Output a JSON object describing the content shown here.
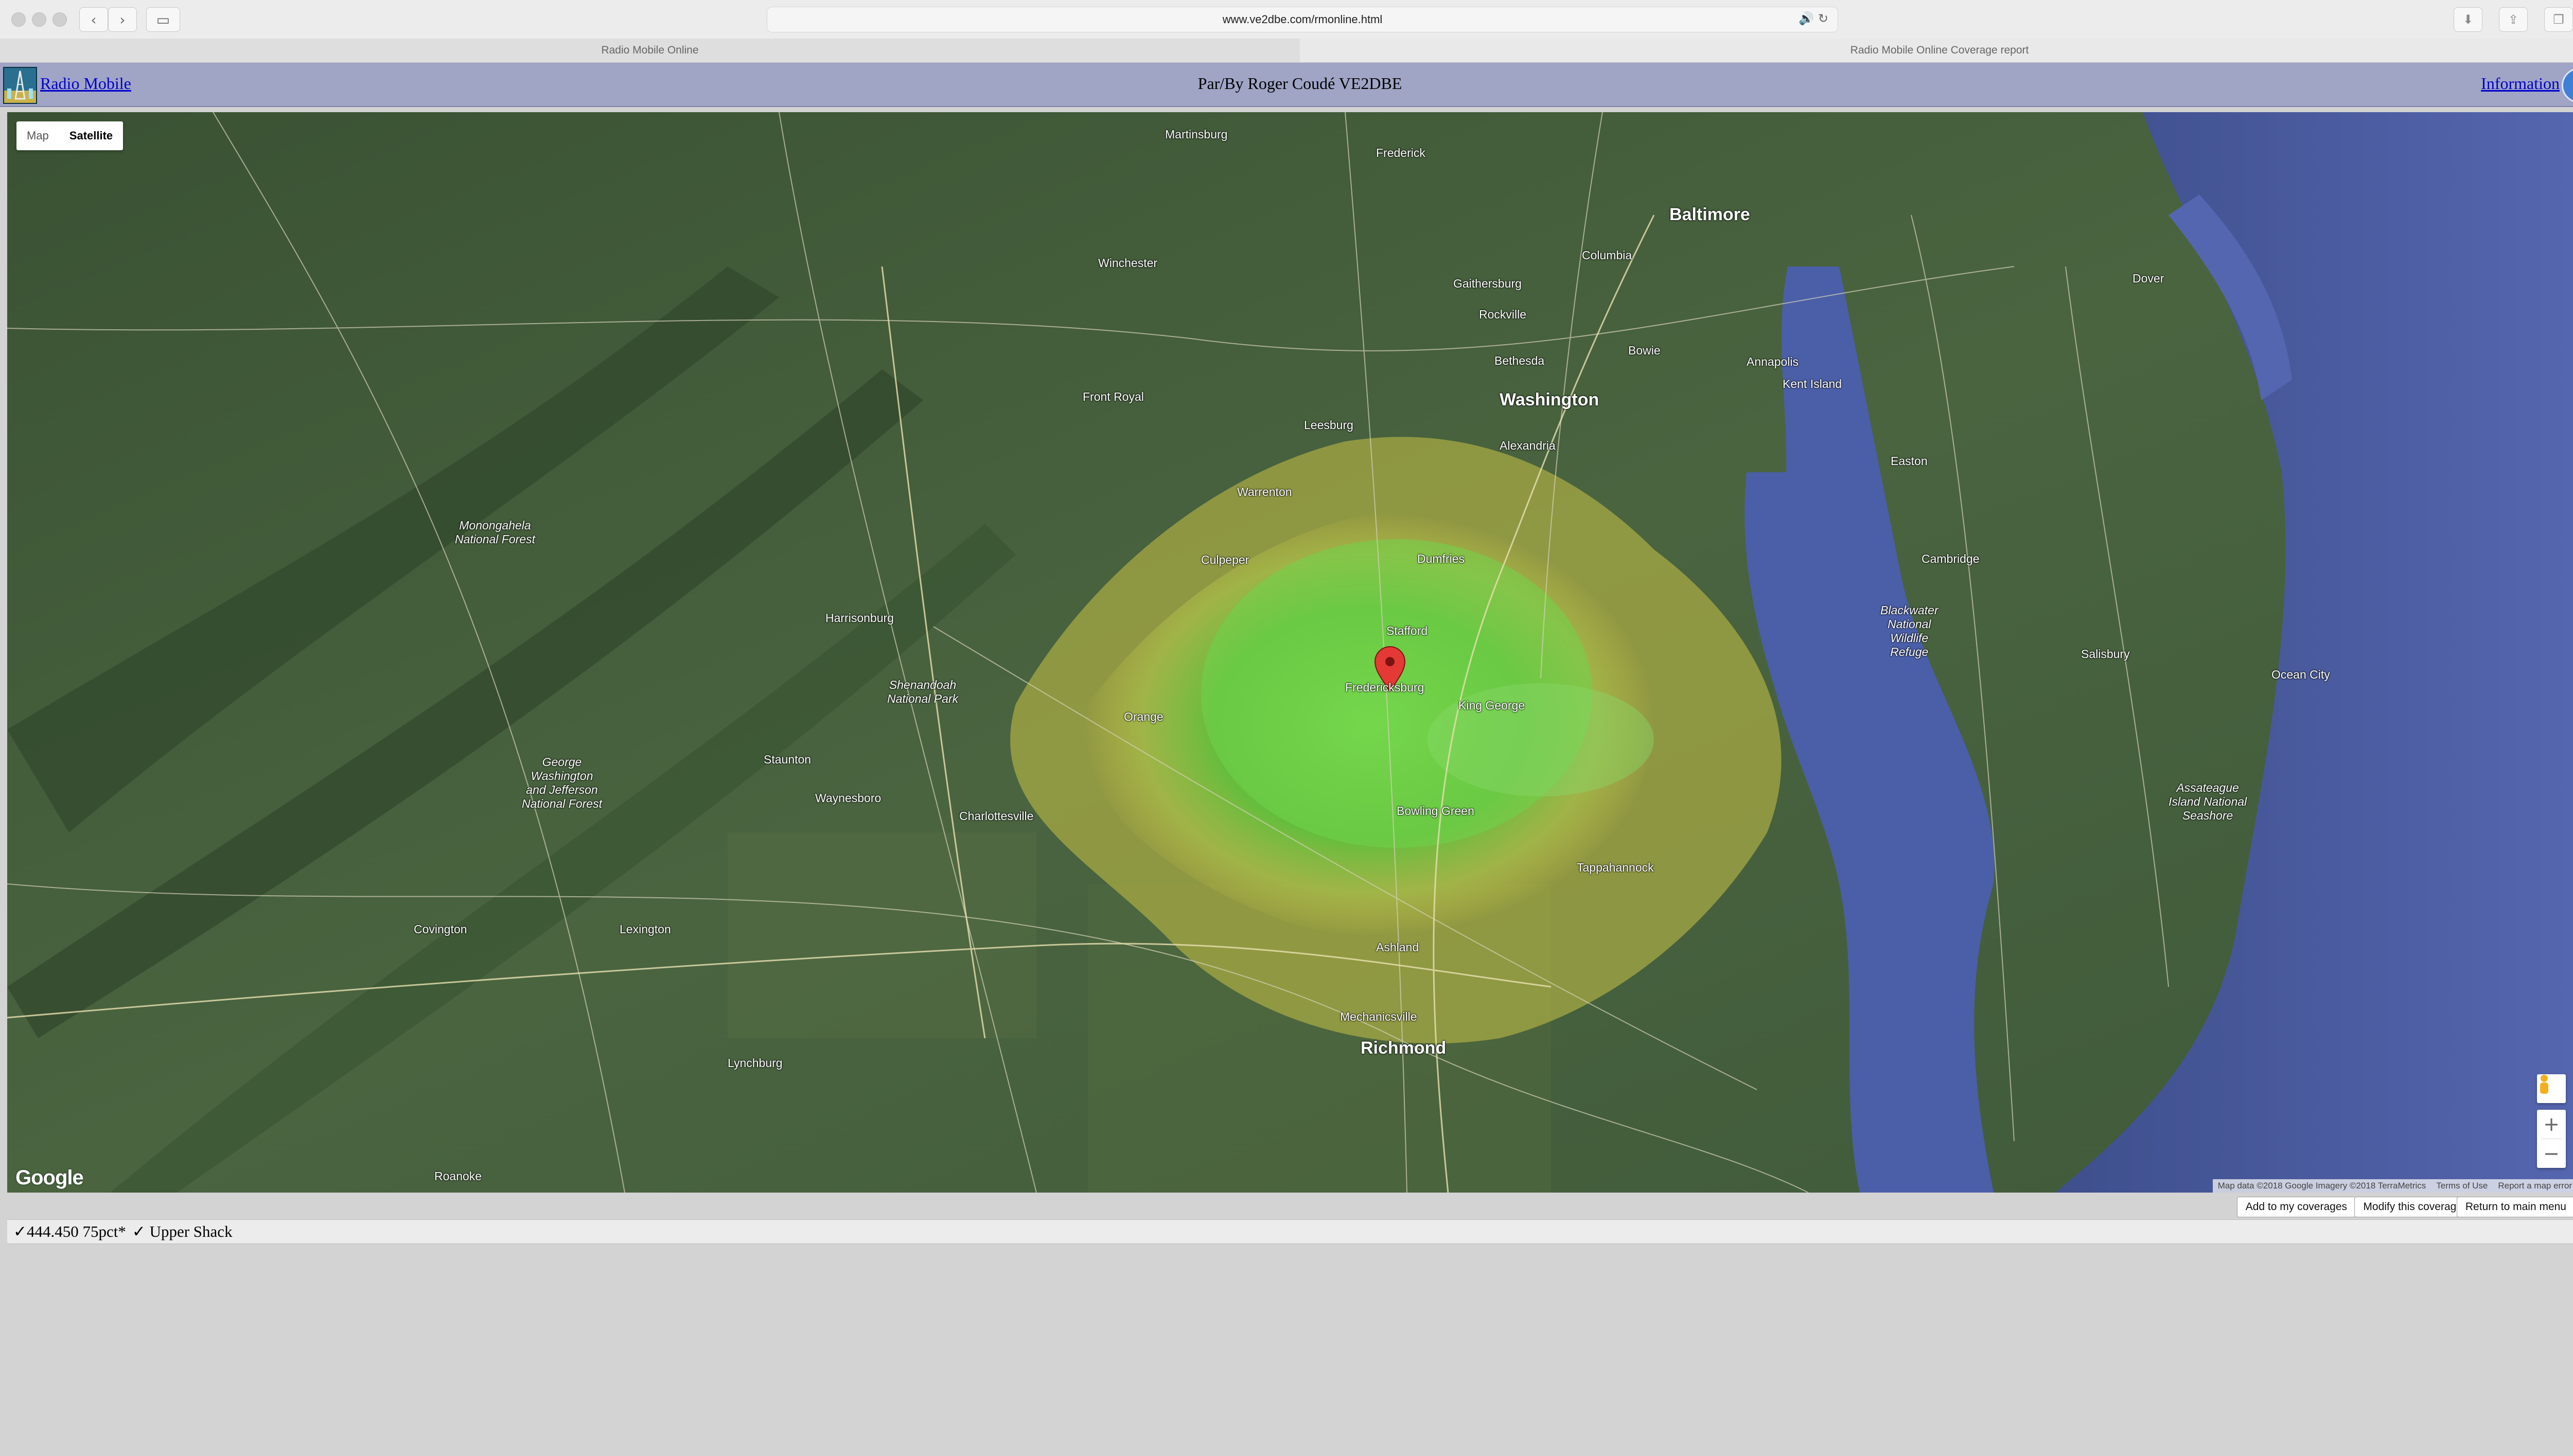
{
  "browser": {
    "url": "www.ve2dbe.com/rmonline.html",
    "tabs": [
      {
        "label": "Radio Mobile Online"
      },
      {
        "label": "Radio Mobile Online Coverage report"
      }
    ]
  },
  "header": {
    "left_link": "Radio Mobile",
    "title": "Par/By Roger Coudé VE2DBE",
    "right_link": "Information"
  },
  "map": {
    "type_buttons": {
      "map": "Map",
      "satellite": "Satellite"
    },
    "active_type": "Satellite",
    "logo": "Google",
    "attribution": {
      "data": "Map data ©2018 Google Imagery ©2018 TerraMetrics",
      "terms": "Terms of Use",
      "report": "Report a map error"
    },
    "zoom": {
      "in": "+",
      "out": "−"
    },
    "places": {
      "baltimore": "Baltimore",
      "washington": "Washington",
      "richmond": "Richmond",
      "charlottesville": "Charlottesville",
      "frederick": "Frederick",
      "annapolis": "Annapolis",
      "alexandria": "Alexandria",
      "fredericksburg": "Fredericksburg",
      "stafford": "Stafford",
      "winchester": "Winchester",
      "harrisonburg": "Harrisonburg",
      "staunton": "Staunton",
      "lynchburg": "Lynchburg",
      "culpeper": "Culpeper",
      "warrenton": "Warrenton",
      "leesburg": "Leesburg",
      "dover": "Dover",
      "salisbury": "Salisbury",
      "ocean_city": "Ocean City",
      "cambridge": "Cambridge",
      "easton": "Easton",
      "mechanicsville": "Mechanicsville",
      "gaithersburg": "Gaithersburg",
      "bethesda": "Bethesda",
      "rockville": "Rockville",
      "bowie": "Bowie",
      "columbia": "Columbia",
      "dumfries": "Dumfries",
      "front_royal": "Front Royal",
      "martinsburg": "Martinsburg",
      "waynesboro": "Waynesboro",
      "orange": "Orange",
      "bowling_green": "Bowling Green",
      "king_george": "King George",
      "tappahannock": "Tappahannock",
      "ashland": "Ashland",
      "lexington": "Lexington",
      "covington": "Covington",
      "roanoke": "Roanoke",
      "kent_island": "Kent Island",
      "shenandoah": "Shenandoah\nNational Park",
      "george_washington": "George\nWashington\nand Jefferson\nNational Forest",
      "monongahela": "Monongahela\nNational Forest",
      "blackwater": "Blackwater\nNational\nWildlife\nRefuge",
      "assateague": "Assateague\nIsland National\nSeashore"
    },
    "coverage_color_strong": "#6fd44a",
    "coverage_color_weak": "#c9c245"
  },
  "footer": {
    "add_label": "Add to my coverages",
    "modify_label": "Modify this coverage",
    "return_label": "Return to main menu"
  },
  "legend": {
    "freq": "✓444.450 75pct*",
    "site": "✓ Upper Shack"
  }
}
